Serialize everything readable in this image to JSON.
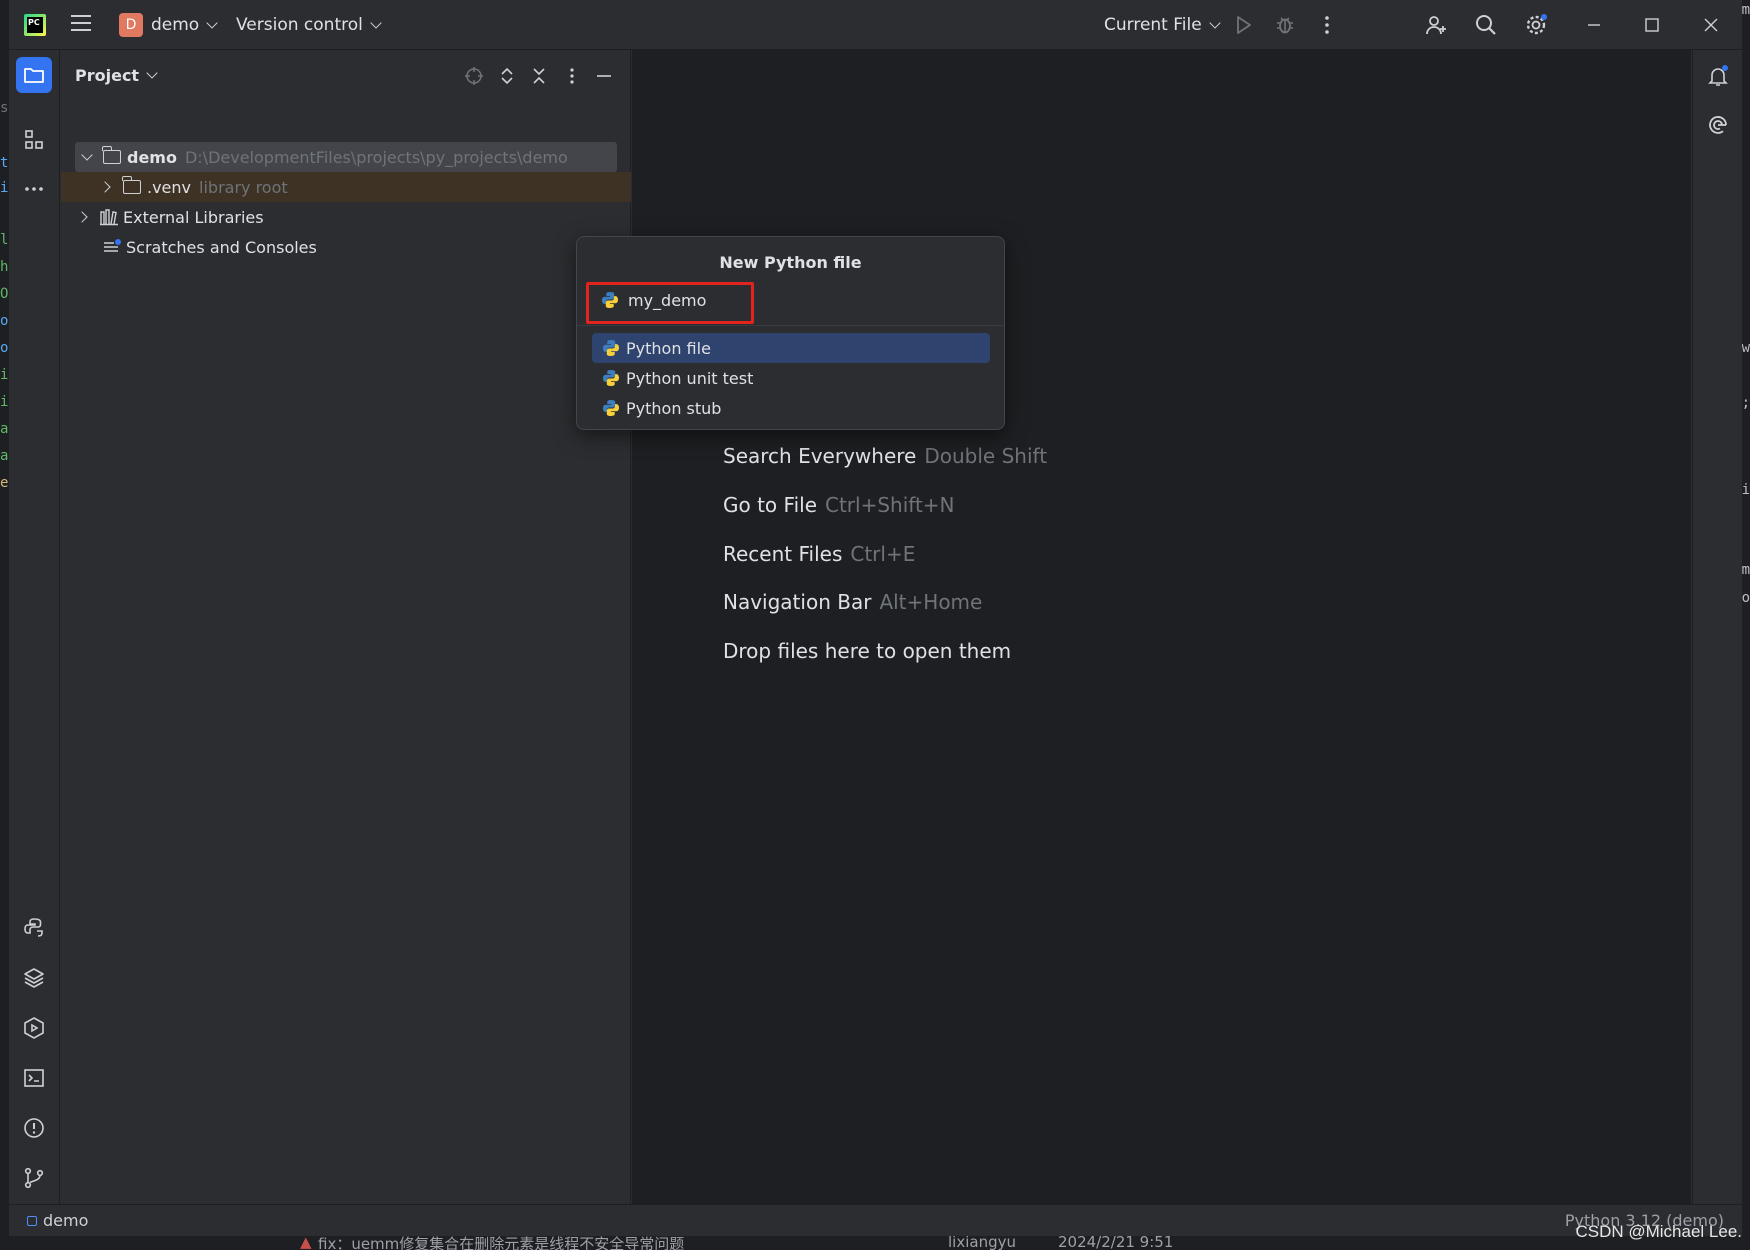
{
  "titlebar": {
    "logo_text": "PC",
    "project_badge": "D",
    "project_name": "demo",
    "version_control": "Version control",
    "run_config": "Current File"
  },
  "project_panel": {
    "title": "Project",
    "tree": [
      {
        "name": "demo",
        "hint": "D:\\DevelopmentFiles\\projects\\py_projects\\demo"
      },
      {
        "name": ".venv",
        "hint": "library root"
      },
      {
        "name": "External Libraries",
        "hint": ""
      },
      {
        "name": "Scratches and Consoles",
        "hint": ""
      }
    ]
  },
  "editor_hints": [
    {
      "action": "Search Everywhere",
      "shortcut": "Double Shift"
    },
    {
      "action": "Go to File",
      "shortcut": "Ctrl+Shift+N"
    },
    {
      "action": "Recent Files",
      "shortcut": "Ctrl+E"
    },
    {
      "action": "Navigation Bar",
      "shortcut": "Alt+Home"
    },
    {
      "action": "Drop files here to open them",
      "shortcut": ""
    }
  ],
  "popup": {
    "title": "New Python file",
    "input_value": "my_demo",
    "options": [
      "Python file",
      "Python unit test",
      "Python stub"
    ],
    "selected_index": 0
  },
  "statusbar": {
    "breadcrumb": "demo",
    "interpreter": "Python 3.12 (demo)"
  },
  "background": {
    "commit_message": "fix：uemm修复集合在删除元素是线程不安全导常问题",
    "commit_author": "lixiangyu",
    "commit_time": "2024/2/21 9:51"
  },
  "watermark": "CSDN @Michael Lee.",
  "colors": {
    "accent": "#3574f0",
    "selection": "#2e436e",
    "highlight_box": "#e3231d",
    "project_badge": "#e0795f"
  }
}
